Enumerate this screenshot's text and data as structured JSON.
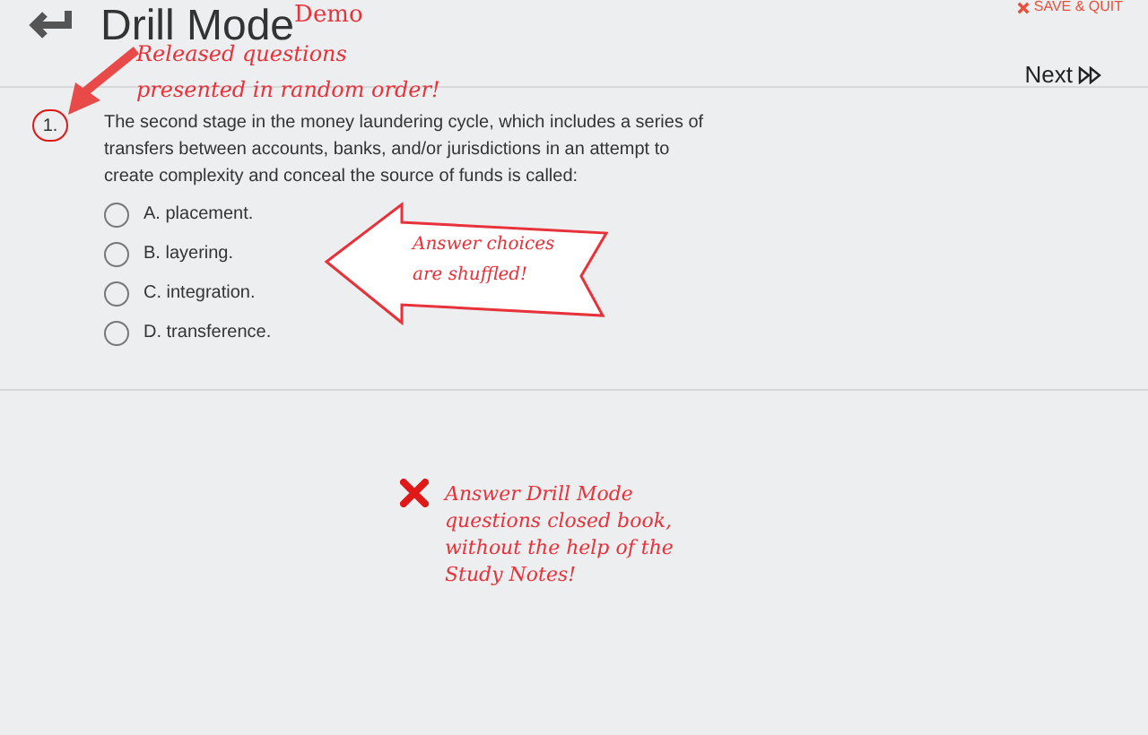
{
  "header": {
    "title": "Drill Mode",
    "badge": "Demo",
    "save_quit": "SAVE & QUIT"
  },
  "navigation": {
    "next": "Next"
  },
  "question": {
    "number": "1.",
    "text": "The second stage in the money laundering cycle, which includes a series of transfers between accounts, banks, and/or jurisdictions in an attempt to create complexity and conceal the source of funds is called:",
    "choices": [
      {
        "label": "A. placement.",
        "selected": false
      },
      {
        "label": "B. layering.",
        "selected": false
      },
      {
        "label": "C. integration.",
        "selected": false
      },
      {
        "label": "D. transference.",
        "selected": false
      }
    ]
  },
  "annotations": [
    {
      "kind": "arrow",
      "text": "Released questions presented in random order!"
    },
    {
      "kind": "callout",
      "text": "Answer choices are shuffled!"
    },
    {
      "kind": "cross",
      "text": "Answer Drill Mode questions closed book, without the help of the Study Notes!"
    }
  ]
}
